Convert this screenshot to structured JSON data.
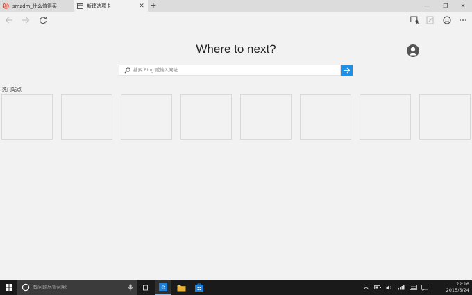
{
  "tabs": [
    {
      "label": "smzdm_什么值得买"
    },
    {
      "label": "新建选项卡"
    }
  ],
  "newtab_label": "+",
  "window": {
    "minimize": "—",
    "maximize": "❐",
    "close": "✕"
  },
  "content": {
    "heading": "Where to next?",
    "search_placeholder": "搜索 Bing 或输入网址",
    "top_sites_label": "热门站点",
    "tile_count": 8
  },
  "taskbar": {
    "search_label": "有问题尽管问我",
    "time": "22:16",
    "date": "2015/5/24"
  },
  "colors": {
    "accent": "#1e90e6",
    "background": "#f2f2f2",
    "taskbar": "#1a1a1a"
  },
  "icons": [
    "back-icon",
    "forward-icon",
    "refresh-icon",
    "reading-view-icon",
    "web-note-icon",
    "feedback-icon",
    "more-icon",
    "search-icon",
    "arrow-right-icon",
    "windows-logo-icon",
    "microphone-icon",
    "task-view-icon",
    "edge-icon",
    "file-explorer-icon",
    "store-icon",
    "chevron-up-icon",
    "battery-icon",
    "volume-icon",
    "network-icon",
    "keyboard-icon",
    "notification-icon"
  ]
}
